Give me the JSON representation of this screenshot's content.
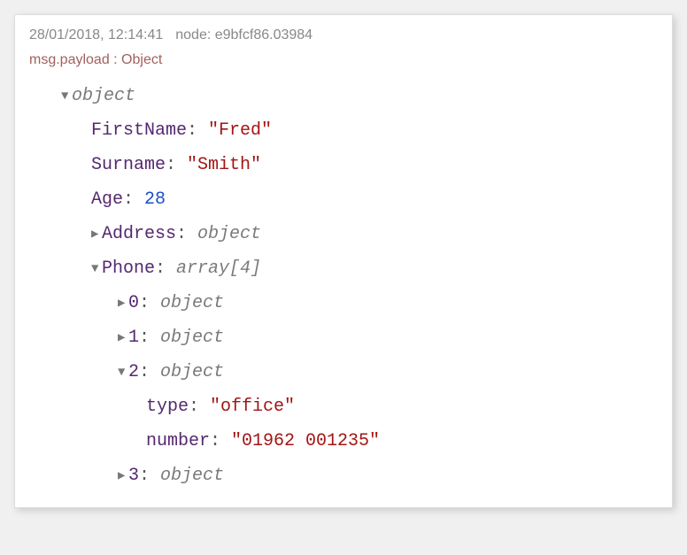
{
  "header": {
    "timestamp": "28/01/2018, 12:14:41",
    "node_prefix": "node: ",
    "node_id": "e9bfcf86.03984"
  },
  "subheader": {
    "path": "msg.payload : Object"
  },
  "tree": {
    "root_type": "object",
    "keys": {
      "firstName": "FirstName",
      "surname": "Surname",
      "age": "Age",
      "address": "Address",
      "phone": "Phone",
      "type": "type",
      "number": "number"
    },
    "values": {
      "firstName": "\"Fred\"",
      "surname": "\"Smith\"",
      "age": "28",
      "address_type": "object",
      "phone_type": "array[4]",
      "phone0_type": "object",
      "phone1_type": "object",
      "phone2_type": "object",
      "phone2_typeval": "\"office\"",
      "phone2_number": "\"01962 001235\"",
      "phone3_type": "object"
    },
    "indices": {
      "i0": "0",
      "i1": "1",
      "i2": "2",
      "i3": "3"
    }
  }
}
